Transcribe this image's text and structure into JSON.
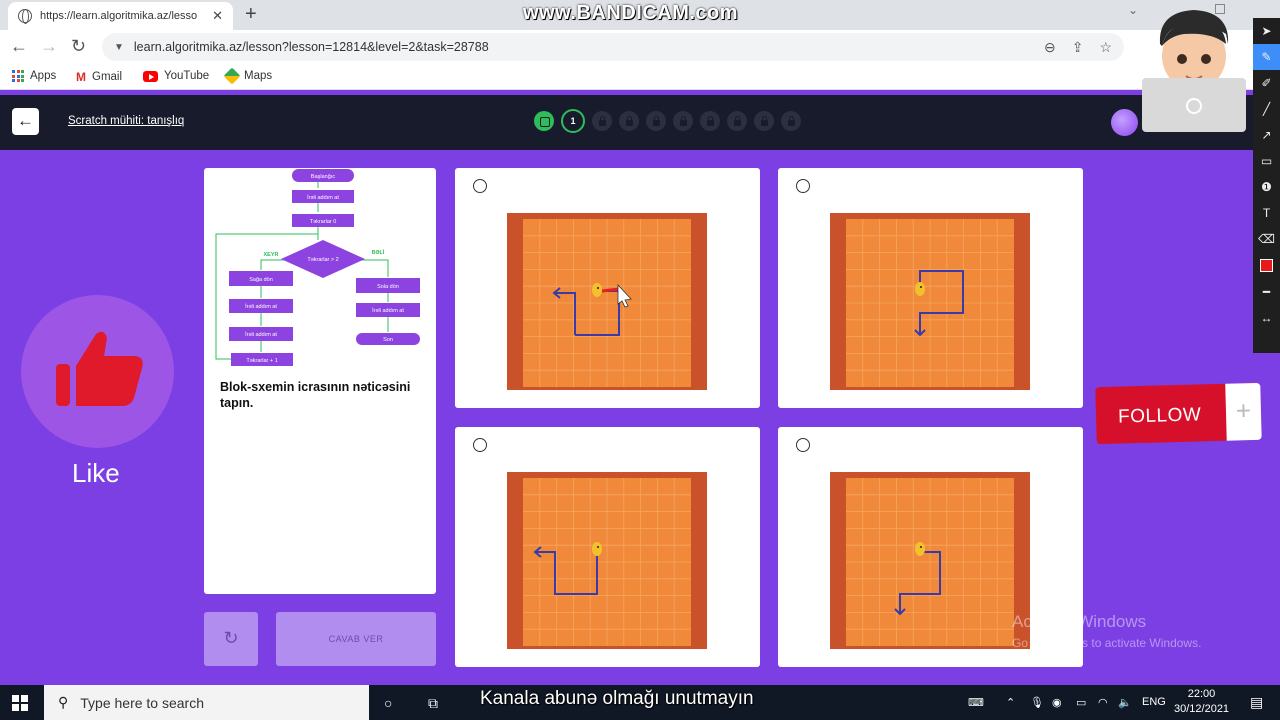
{
  "browser": {
    "tab_title": "https://learn.algoritmika.az/lesso",
    "url": "learn.algoritmika.az/lesson?lesson=12814&level=2&task=28788",
    "bookmarks": [
      "Apps",
      "Gmail",
      "YouTube",
      "Maps"
    ]
  },
  "recording_watermark": "www.BANDICAM.com",
  "app": {
    "course_title": "Scratch mühiti: tanışlıq",
    "current_step": "1",
    "step_states": [
      "done",
      "current",
      "locked",
      "locked",
      "locked",
      "locked",
      "locked",
      "locked",
      "locked",
      "locked"
    ]
  },
  "task": {
    "prompt": "Blok-sxemin icrasının nəticəsini tapın.",
    "flowchart": {
      "start": "Başlanğıc",
      "step1": "İrəli addım at",
      "assign": "Təkrarlar 0",
      "condition": "Təkrarlar > 2",
      "no_label": "XEYR",
      "yes_label": "BƏLİ",
      "no_1": "Sağa dön",
      "no_2": "İrəli addım at",
      "no_3": "İrəli addım at",
      "no_4": "Təkrarlar + 1",
      "yes_1": "Sola dön",
      "yes_2": "İrəli addım at",
      "end": "Son"
    },
    "submit_label": "CAVAB VER",
    "reset_icon": "reset-icon",
    "options_count": 4
  },
  "overlays": {
    "like_label": "Like",
    "follow_label": "FOLLOW",
    "follow_plus": "+",
    "activate_title": "Activate Windows",
    "activate_sub": "Go to Settings to activate Windows."
  },
  "colors": {
    "page_bg": "#7b3fe4",
    "header_bg": "#181b2b",
    "flow_purple": "#8d43e0",
    "grid_orange": "#f08a3a",
    "path_blue": "#3a3aa8",
    "follow_red": "#d6102b"
  },
  "taskbar": {
    "search_placeholder": "Type here to search",
    "subtitle": "Kanala abunə olmağı unutmayın",
    "language": "ENG",
    "time": "22:00",
    "date": "30/12/2021"
  }
}
